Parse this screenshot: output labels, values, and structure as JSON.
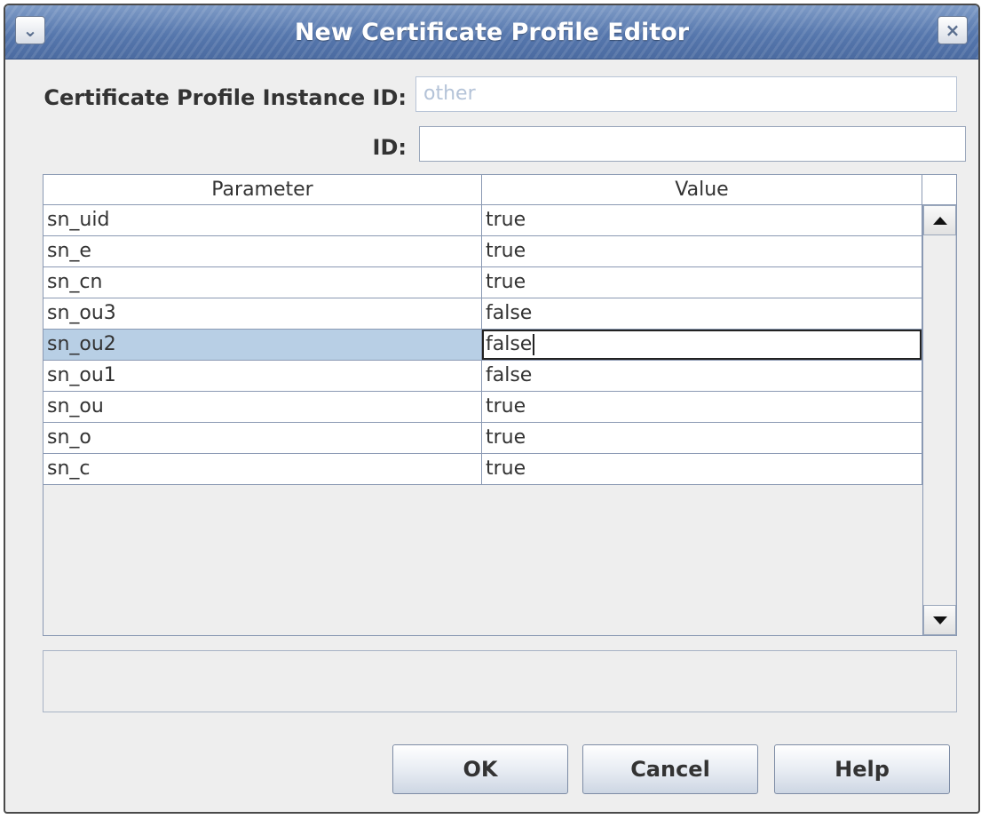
{
  "window": {
    "title": "New Certificate Profile Editor",
    "menu_icon": "chevron-down-icon",
    "close_icon": "close-icon"
  },
  "form": {
    "instance_id_label": "Certificate Profile Instance ID:",
    "instance_id_value": "other",
    "id_label": "ID:",
    "id_value": ""
  },
  "table": {
    "columns": [
      "Parameter",
      "Value"
    ],
    "rows": [
      {
        "parameter": "sn_uid",
        "value": "true"
      },
      {
        "parameter": "sn_e",
        "value": "true"
      },
      {
        "parameter": "sn_cn",
        "value": "true"
      },
      {
        "parameter": "sn_ou3",
        "value": "false"
      },
      {
        "parameter": "sn_ou2",
        "value": "false"
      },
      {
        "parameter": "sn_ou1",
        "value": "false"
      },
      {
        "parameter": "sn_ou",
        "value": "true"
      },
      {
        "parameter": "sn_o",
        "value": "true"
      },
      {
        "parameter": "sn_c",
        "value": "true"
      }
    ],
    "selected_row": 4
  },
  "status_text": "",
  "buttons": {
    "ok": "OK",
    "cancel": "Cancel",
    "help": "Help"
  },
  "colors": {
    "titlebar": "#5677ad",
    "selection": "#b8cfe5",
    "background": "#eeeeee"
  }
}
